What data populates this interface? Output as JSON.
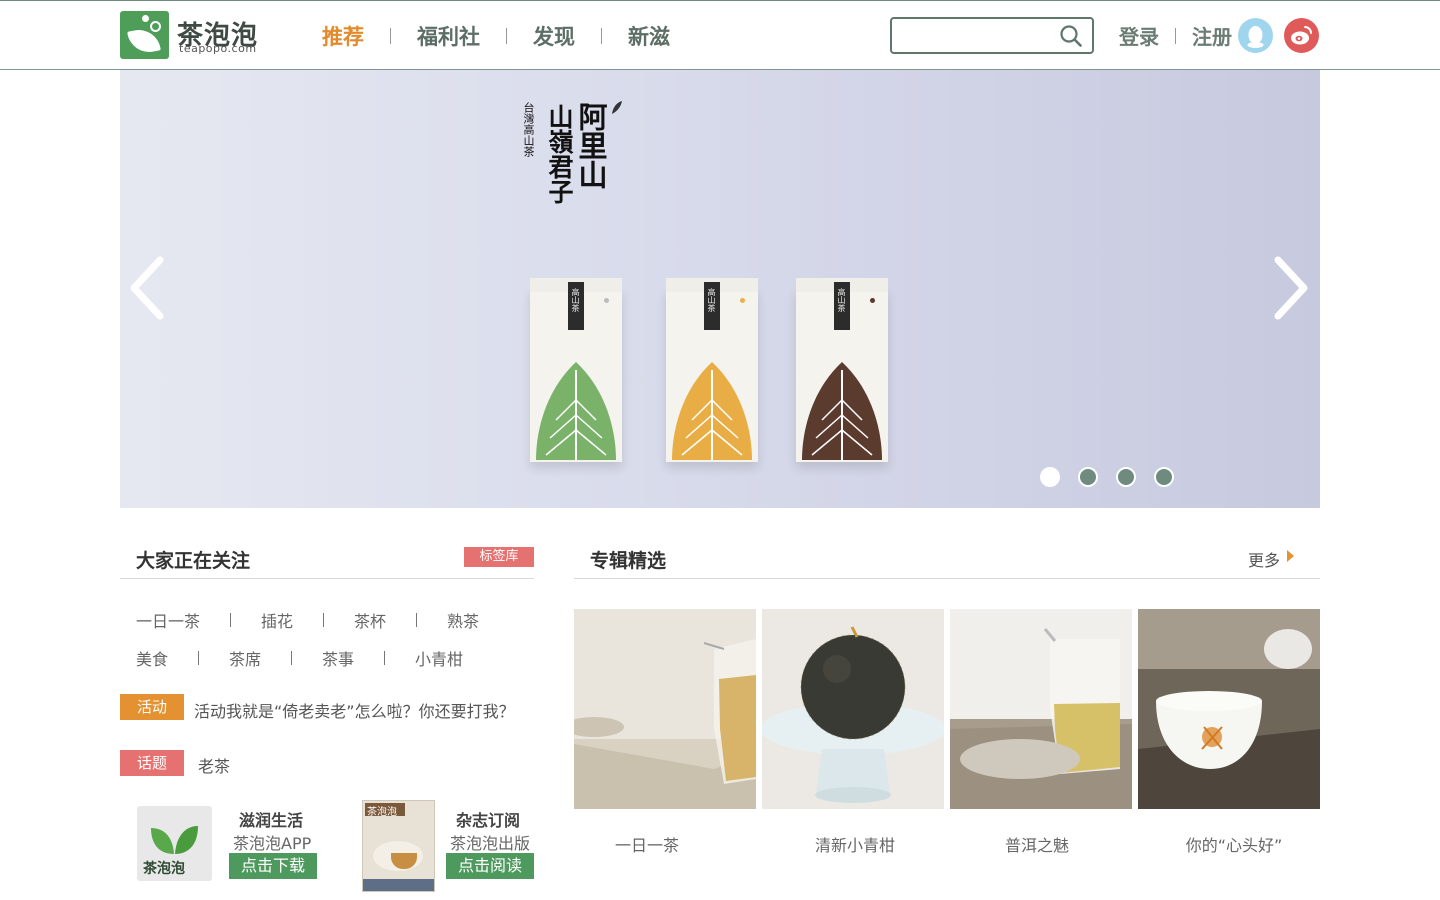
{
  "header": {
    "logo_name": "茶泡泡",
    "logo_sub": "teapopo.com",
    "nav": [
      {
        "label": "推荐",
        "active": true
      },
      {
        "label": "福利社",
        "active": false
      },
      {
        "label": "发现",
        "active": false
      },
      {
        "label": "新滋",
        "active": false
      }
    ],
    "search_placeholder": "",
    "login_label": "登录",
    "register_label": "注册",
    "icons": [
      "search-icon",
      "qq-icon",
      "weibo-icon"
    ],
    "accent_color": "#e28a2c",
    "brand_color": "#4e9e5a"
  },
  "banner": {
    "title_main": "阿里山",
    "title_sub": "山嶺君子",
    "title_small": "台灣高山茶",
    "box_label": "高山茶",
    "slides_total": 4,
    "active_slide": 1
  },
  "follow": {
    "title": "大家正在关注",
    "tag_library": "标签库",
    "tags_row1": [
      "一日一茶",
      "插花",
      "茶杯",
      "熟茶"
    ],
    "tags_row2": [
      "美食",
      "茶席",
      "茶事",
      "小青柑"
    ],
    "activity_badge": "活动",
    "activity_text": "活动我就是“倚老卖老”怎么啦？你还要打我？",
    "topic_badge": "话题",
    "topic_text": "老茶"
  },
  "promos": {
    "app": {
      "title": "滋润生活",
      "sub": "茶泡泡APP",
      "button": "点击下载",
      "icon_text": "茶泡泡"
    },
    "magazine": {
      "title": "杂志订阅",
      "sub": "茶泡泡出版",
      "button": "点击阅读",
      "cover_text": "茶泡泡"
    }
  },
  "albums": {
    "title": "专辑精选",
    "more": "更多",
    "items": [
      {
        "caption": "一日一茶"
      },
      {
        "caption": "清新小青柑"
      },
      {
        "caption": "普洱之魅"
      },
      {
        "caption": "你的“心头好”"
      }
    ]
  }
}
